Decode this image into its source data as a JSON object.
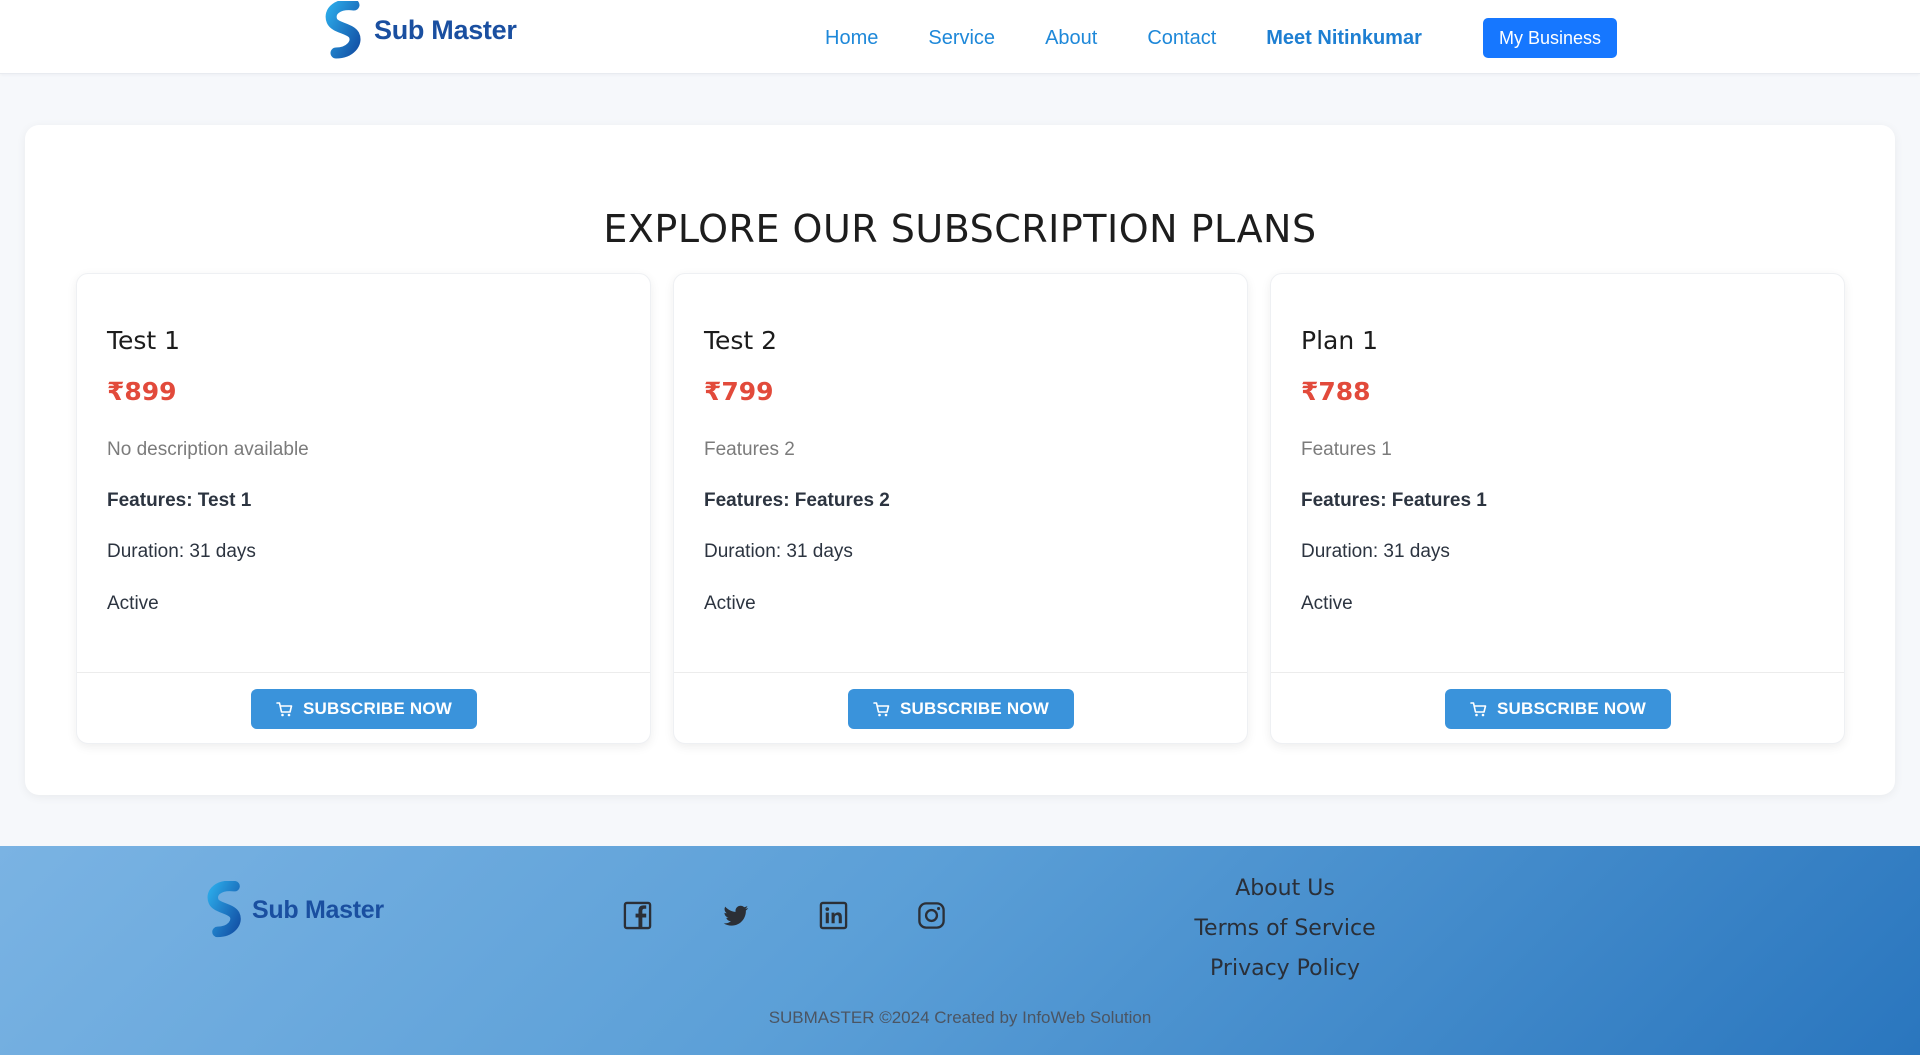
{
  "header": {
    "brand": "Sub Master",
    "nav": {
      "home": "Home",
      "service": "Service",
      "about": "About",
      "contact": "Contact",
      "meet": "Meet Nitinkumar"
    },
    "cta": "My Business"
  },
  "main": {
    "title": "EXPLORE OUR SUBSCRIPTION PLANS",
    "plans": [
      {
        "name": "Test 1",
        "price": "₹899",
        "description": "No description available",
        "features": "Features: Test 1",
        "duration": "Duration: 31 days",
        "status": "Active",
        "button": "SUBSCRIBE NOW"
      },
      {
        "name": "Test 2",
        "price": "₹799",
        "description": "Features 2",
        "features": "Features: Features 2",
        "duration": "Duration: 31 days",
        "status": "Active",
        "button": "SUBSCRIBE NOW"
      },
      {
        "name": "Plan 1",
        "price": "₹788",
        "description": "Features 1",
        "features": "Features: Features 1",
        "duration": "Duration: 31 days",
        "status": "Active",
        "button": "SUBSCRIBE NOW"
      }
    ]
  },
  "footer": {
    "brand": "Sub Master",
    "socials": [
      "facebook-icon",
      "twitter-icon",
      "linkedin-icon",
      "instagram-icon"
    ],
    "links": {
      "about": "About Us",
      "terms": "Terms of Service",
      "privacy": "Privacy Policy"
    },
    "copyright": "SUBMASTER ©2024 Created by InfoWeb Solution"
  },
  "colors": {
    "accent": "#1677ff",
    "nav_link": "#1e88d9",
    "price": "#e24a3b",
    "subscribe_button": "#3a93db",
    "brand_text": "#1a4fa0"
  }
}
